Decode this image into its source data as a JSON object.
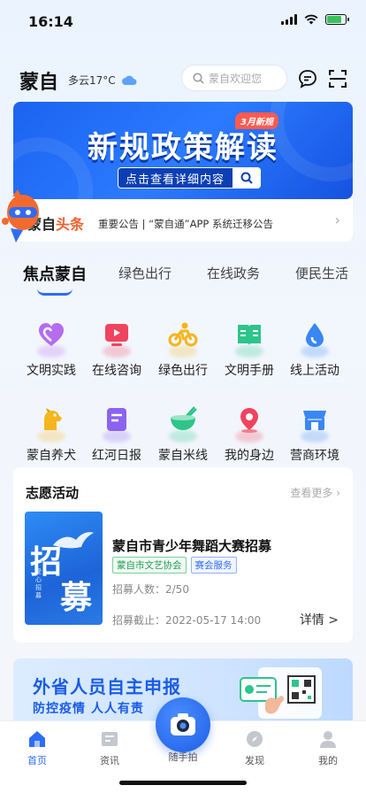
{
  "status_bar": {
    "time": "16:14",
    "battery_level": 0.8
  },
  "header": {
    "city": "蒙自",
    "weather": "多云17°C",
    "search_placeholder": "蒙自欢迎您"
  },
  "banner": {
    "title": "新规政策解读",
    "tag": "3月新规",
    "button": "点击查看详细内容"
  },
  "news": {
    "label_main": "蒙自",
    "label_highlight": "头条",
    "text": "重要公告 | “蒙自通”APP 系统迁移公告"
  },
  "tabs": [
    "焦点蒙自",
    "绿色出行",
    "在线政务",
    "便民生活"
  ],
  "grid": [
    {
      "label": "文明实践",
      "icon": "heart-icon",
      "color": "#b46cf0"
    },
    {
      "label": "在线咨询",
      "icon": "tv-icon",
      "color": "#f0435e"
    },
    {
      "label": "绿色出行",
      "icon": "bicycle-icon",
      "color": "#f5b51c"
    },
    {
      "label": "文明手册",
      "icon": "book-icon",
      "color": "#2dc58a"
    },
    {
      "label": "线上活动",
      "icon": "drop-icon",
      "color": "#3a86f5"
    },
    {
      "label": "蒙自养犬",
      "icon": "dog-icon",
      "color": "#f5b51c"
    },
    {
      "label": "红河日报",
      "icon": "newspaper-icon",
      "color": "#8a63f0"
    },
    {
      "label": "蒙自米线",
      "icon": "bowl-icon",
      "color": "#2dc58a"
    },
    {
      "label": "我的身边",
      "icon": "location-icon",
      "color": "#f0435e"
    },
    {
      "label": "营商环境",
      "icon": "shop-icon",
      "color": "#3a86f5"
    }
  ],
  "volunteer": {
    "title": "志愿活动",
    "more": "查看更多 ›",
    "poster_big_1": "招",
    "poster_big_2": "募",
    "poster_small": "爱心招募",
    "name": "蒙自市青少年舞蹈大赛招募",
    "tags": [
      "蒙自市文艺协会",
      "赛会服务"
    ],
    "count": "招募人数：2/50",
    "deadline": "招募截止：2022-05-17 14:00",
    "detail": "详情 >"
  },
  "ad": {
    "title": "外省人员自主申报",
    "subtitle": "防控疫情  人人有责"
  },
  "tabbar": {
    "items": [
      "首页",
      "资讯",
      "随手拍",
      "发现",
      "我的"
    ]
  }
}
